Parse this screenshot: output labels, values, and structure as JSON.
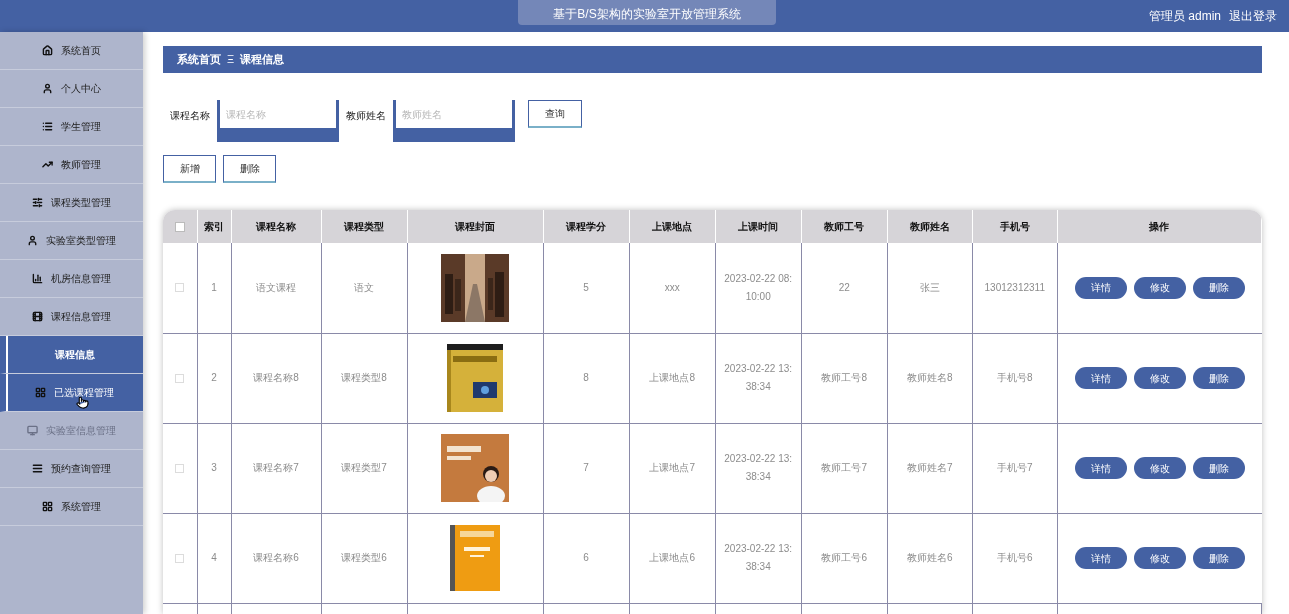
{
  "header": {
    "title": "基于B/S架构的实验室开放管理系统",
    "user": "管理员 admin",
    "logout": "退出登录"
  },
  "sidebar": {
    "items": [
      {
        "label": "系统首页",
        "selected": false,
        "hovered": false,
        "dimmed": false
      },
      {
        "label": "个人中心",
        "selected": false,
        "hovered": false,
        "dimmed": false
      },
      {
        "label": "学生管理",
        "selected": false,
        "hovered": false,
        "dimmed": false
      },
      {
        "label": "教师管理",
        "selected": false,
        "hovered": false,
        "dimmed": false
      },
      {
        "label": "课程类型管理",
        "selected": false,
        "hovered": false,
        "dimmed": false
      },
      {
        "label": "实验室类型管理",
        "selected": false,
        "hovered": false,
        "dimmed": false
      },
      {
        "label": "机房信息管理",
        "selected": false,
        "hovered": false,
        "dimmed": false
      },
      {
        "label": "课程信息管理",
        "selected": false,
        "hovered": false,
        "dimmed": false
      },
      {
        "label": "课程信息",
        "selected": true,
        "hovered": false,
        "dimmed": false
      },
      {
        "label": "已选课程管理",
        "selected": false,
        "hovered": true,
        "dimmed": false
      },
      {
        "label": "实验室信息管理",
        "selected": false,
        "hovered": false,
        "dimmed": true
      },
      {
        "label": "预约查询管理",
        "selected": false,
        "hovered": false,
        "dimmed": false
      },
      {
        "label": "系统管理",
        "selected": false,
        "hovered": false,
        "dimmed": false
      }
    ]
  },
  "breadcrumb": {
    "home": "系统首页",
    "separator": "Ξ",
    "current": "课程信息"
  },
  "search": {
    "fields": [
      {
        "label": "课程名称",
        "placeholder": "课程名称"
      },
      {
        "label": "教师姓名",
        "placeholder": "教师姓名"
      }
    ],
    "button": "查询"
  },
  "actions": [
    "新增",
    "删除"
  ],
  "table": {
    "select_all_checked": false,
    "columns": [
      "索引",
      "课程名称",
      "课程类型",
      "课程封面",
      "课程学分",
      "上课地点",
      "上课时间",
      "教师工号",
      "教师姓名",
      "手机号",
      "操作"
    ],
    "rows": [
      {
        "checked": false,
        "cells": [
          "1",
          "语文课程",
          "语文",
          null,
          "5",
          "xxx",
          "2023-02-22 08:10:00",
          "22",
          "张三",
          "13012312311"
        ],
        "buttons": [
          "详情",
          "修改",
          "删除"
        ]
      },
      {
        "checked": false,
        "cells": [
          "2",
          "课程名称8",
          "课程类型8",
          null,
          "8",
          "上课地点8",
          "2023-02-22 13:38:34",
          "教师工号8",
          "教师姓名8",
          "手机号8"
        ],
        "buttons": [
          "详情",
          "修改",
          "删除"
        ]
      },
      {
        "checked": false,
        "cells": [
          "3",
          "课程名称7",
          "课程类型7",
          null,
          "7",
          "上课地点7",
          "2023-02-22 13:38:34",
          "教师工号7",
          "教师姓名7",
          "手机号7"
        ],
        "buttons": [
          "详情",
          "修改",
          "删除"
        ]
      },
      {
        "checked": false,
        "cells": [
          "4",
          "课程名称6",
          "课程类型6",
          null,
          "6",
          "上课地点6",
          "2023-02-22 13:38:34",
          "教师工号6",
          "教师姓名6",
          "手机号6"
        ],
        "buttons": [
          "详情",
          "修改",
          "删除"
        ]
      }
    ]
  }
}
